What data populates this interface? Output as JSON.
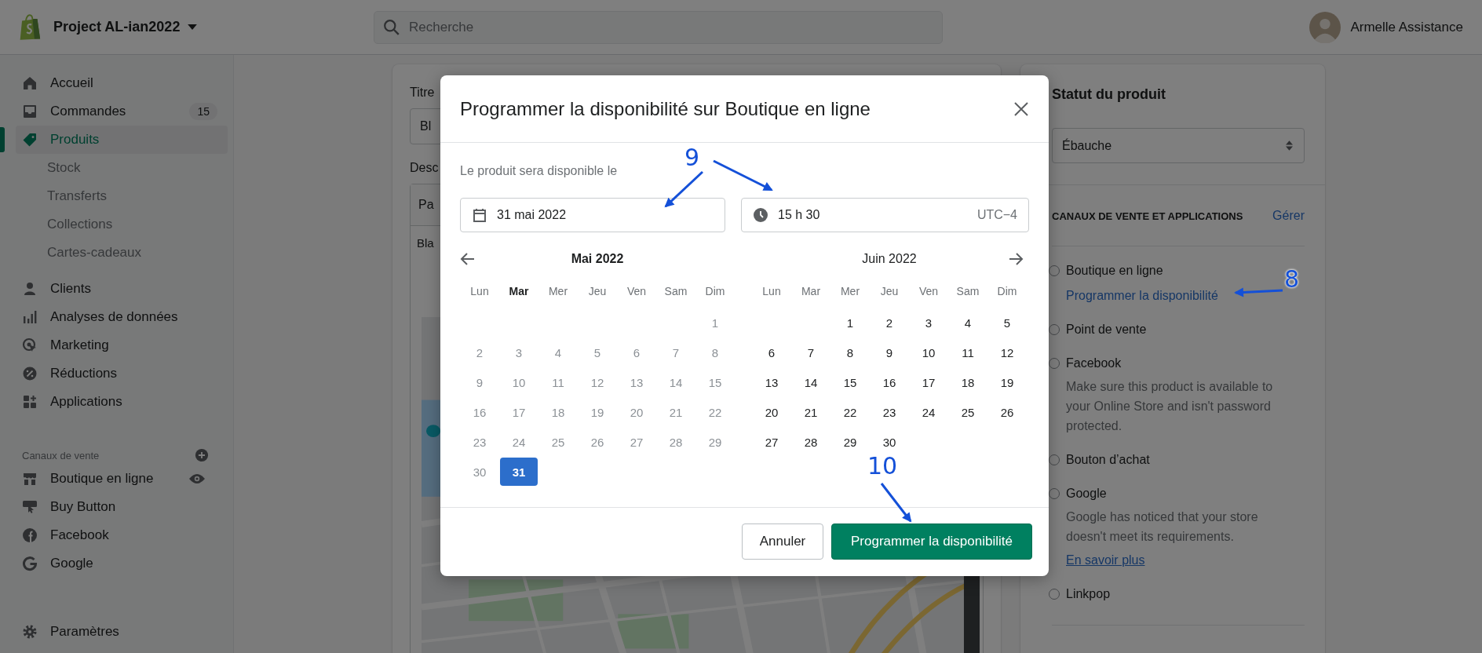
{
  "topbar": {
    "store_name": "Project AL-ian2022",
    "search": {
      "placeholder": "Recherche"
    },
    "user": {
      "name": "Armelle Assistance"
    }
  },
  "sidebar": {
    "items": [
      {
        "label": "Accueil",
        "selected": false
      },
      {
        "label": "Commandes",
        "badge": "15",
        "selected": false
      },
      {
        "label": "Produits",
        "selected": true,
        "children": [
          {
            "label": "Stock",
            "selected": false
          },
          {
            "label": "Transferts",
            "selected": false
          },
          {
            "label": "Collections",
            "selected": false
          },
          {
            "label": "Cartes-cadeaux",
            "selected": false
          }
        ]
      },
      {
        "label": "Clients",
        "selected": false
      },
      {
        "label": "Analyses de données",
        "selected": false
      },
      {
        "label": "Marketing",
        "selected": false
      },
      {
        "label": "Réductions",
        "selected": false
      },
      {
        "label": "Applications",
        "selected": false
      }
    ],
    "channels_heading": "Canaux de vente",
    "channels": [
      {
        "label": "Boutique en ligne"
      },
      {
        "label": "Buy Button"
      },
      {
        "label": "Facebook"
      },
      {
        "label": "Google"
      }
    ],
    "settings": {
      "label": "Paramètres"
    }
  },
  "product_form": {
    "title_label": "Titre",
    "title_value": "Bl",
    "description_label": "Desc",
    "editor_toolbar": "Pa",
    "editor_text": "Bla"
  },
  "status_card": {
    "title": "Statut du produit",
    "status_select": "Ébauche",
    "channels_heading": "CANAUX DE VENTE ET APPLICATIONS",
    "manage_link": "Gérer",
    "channels": [
      {
        "name": "Boutique en ligne",
        "checked": false,
        "link": "Programmer la disponibilité"
      },
      {
        "name": "Point de vente",
        "checked": false
      },
      {
        "name": "Facebook",
        "checked": false,
        "note": "Make sure this product is available to your Online Store and isn't password protected."
      },
      {
        "name": "Bouton d’achat",
        "checked": false
      },
      {
        "name": "Google",
        "checked": false,
        "note": "Google has noticed that your store doesn't meet its requirements.",
        "note_link": "En savoir plus"
      },
      {
        "name": "Linkpop",
        "checked": false
      }
    ]
  },
  "modal": {
    "title": "Programmer la disponibilité sur Boutique en ligne",
    "intro": "Le produit sera disponible le",
    "date_field": {
      "value": "31 mai 2022"
    },
    "time_field": {
      "value": "15 h 30",
      "timezone": "UTC−4"
    },
    "calendar": {
      "months": [
        {
          "title": "Mai 2022",
          "current": true,
          "weekdays": [
            {
              "label": "Lun",
              "current": false
            },
            {
              "label": "Mar",
              "current": true
            },
            {
              "label": "Mer",
              "current": false
            },
            {
              "label": "Jeu",
              "current": false
            },
            {
              "label": "Ven",
              "current": false
            },
            {
              "label": "Sam",
              "current": false
            },
            {
              "label": "Dim",
              "current": false
            }
          ],
          "weeks": [
            [
              {
                "kind": "blank"
              },
              {
                "kind": "blank"
              },
              {
                "kind": "blank"
              },
              {
                "kind": "blank"
              },
              {
                "kind": "blank"
              },
              {
                "kind": "blank"
              },
              {
                "kind": "day",
                "label": "1",
                "disabled": true,
                "selected": false
              }
            ],
            [
              {
                "kind": "day",
                "label": "2",
                "disabled": true,
                "selected": false
              },
              {
                "kind": "day",
                "label": "3",
                "disabled": true,
                "selected": false
              },
              {
                "kind": "day",
                "label": "4",
                "disabled": true,
                "selected": false
              },
              {
                "kind": "day",
                "label": "5",
                "disabled": true,
                "selected": false
              },
              {
                "kind": "day",
                "label": "6",
                "disabled": true,
                "selected": false
              },
              {
                "kind": "day",
                "label": "7",
                "disabled": true,
                "selected": false
              },
              {
                "kind": "day",
                "label": "8",
                "disabled": true,
                "selected": false
              }
            ],
            [
              {
                "kind": "day",
                "label": "9",
                "disabled": true,
                "selected": false
              },
              {
                "kind": "day",
                "label": "10",
                "disabled": true,
                "selected": false
              },
              {
                "kind": "day",
                "label": "11",
                "disabled": true,
                "selected": false
              },
              {
                "kind": "day",
                "label": "12",
                "disabled": true,
                "selected": false
              },
              {
                "kind": "day",
                "label": "13",
                "disabled": true,
                "selected": false
              },
              {
                "kind": "day",
                "label": "14",
                "disabled": true,
                "selected": false
              },
              {
                "kind": "day",
                "label": "15",
                "disabled": true,
                "selected": false
              }
            ],
            [
              {
                "kind": "day",
                "label": "16",
                "disabled": true,
                "selected": false
              },
              {
                "kind": "day",
                "label": "17",
                "disabled": true,
                "selected": false
              },
              {
                "kind": "day",
                "label": "18",
                "disabled": true,
                "selected": false
              },
              {
                "kind": "day",
                "label": "19",
                "disabled": true,
                "selected": false
              },
              {
                "kind": "day",
                "label": "20",
                "disabled": true,
                "selected": false
              },
              {
                "kind": "day",
                "label": "21",
                "disabled": true,
                "selected": false
              },
              {
                "kind": "day",
                "label": "22",
                "disabled": true,
                "selected": false
              }
            ],
            [
              {
                "kind": "day",
                "label": "23",
                "disabled": true,
                "selected": false
              },
              {
                "kind": "day",
                "label": "24",
                "disabled": true,
                "selected": false
              },
              {
                "kind": "day",
                "label": "25",
                "disabled": true,
                "selected": false
              },
              {
                "kind": "day",
                "label": "26",
                "disabled": true,
                "selected": false
              },
              {
                "kind": "day",
                "label": "27",
                "disabled": true,
                "selected": false
              },
              {
                "kind": "day",
                "label": "28",
                "disabled": true,
                "selected": false
              },
              {
                "kind": "day",
                "label": "29",
                "disabled": true,
                "selected": false
              }
            ],
            [
              {
                "kind": "day",
                "label": "30",
                "disabled": true,
                "selected": false
              },
              {
                "kind": "day",
                "label": "31",
                "disabled": false,
                "selected": true
              }
            ]
          ]
        },
        {
          "title": "Juin 2022",
          "current": false,
          "weekdays": [
            {
              "label": "Lun",
              "current": false
            },
            {
              "label": "Mar",
              "current": false
            },
            {
              "label": "Mer",
              "current": false
            },
            {
              "label": "Jeu",
              "current": false
            },
            {
              "label": "Ven",
              "current": false
            },
            {
              "label": "Sam",
              "current": false
            },
            {
              "label": "Dim",
              "current": false
            }
          ],
          "weeks": [
            [
              {
                "kind": "blank"
              },
              {
                "kind": "blank"
              },
              {
                "kind": "day",
                "label": "1",
                "disabled": false,
                "selected": false
              },
              {
                "kind": "day",
                "label": "2",
                "disabled": false,
                "selected": false
              },
              {
                "kind": "day",
                "label": "3",
                "disabled": false,
                "selected": false
              },
              {
                "kind": "day",
                "label": "4",
                "disabled": false,
                "selected": false
              },
              {
                "kind": "day",
                "label": "5",
                "disabled": false,
                "selected": false
              }
            ],
            [
              {
                "kind": "day",
                "label": "6",
                "disabled": false,
                "selected": false
              },
              {
                "kind": "day",
                "label": "7",
                "disabled": false,
                "selected": false
              },
              {
                "kind": "day",
                "label": "8",
                "disabled": false,
                "selected": false
              },
              {
                "kind": "day",
                "label": "9",
                "disabled": false,
                "selected": false
              },
              {
                "kind": "day",
                "label": "10",
                "disabled": false,
                "selected": false
              },
              {
                "kind": "day",
                "label": "11",
                "disabled": false,
                "selected": false
              },
              {
                "kind": "day",
                "label": "12",
                "disabled": false,
                "selected": false
              }
            ],
            [
              {
                "kind": "day",
                "label": "13",
                "disabled": false,
                "selected": false
              },
              {
                "kind": "day",
                "label": "14",
                "disabled": false,
                "selected": false
              },
              {
                "kind": "day",
                "label": "15",
                "disabled": false,
                "selected": false
              },
              {
                "kind": "day",
                "label": "16",
                "disabled": false,
                "selected": false
              },
              {
                "kind": "day",
                "label": "17",
                "disabled": false,
                "selected": false
              },
              {
                "kind": "day",
                "label": "18",
                "disabled": false,
                "selected": false
              },
              {
                "kind": "day",
                "label": "19",
                "disabled": false,
                "selected": false
              }
            ],
            [
              {
                "kind": "day",
                "label": "20",
                "disabled": false,
                "selected": false
              },
              {
                "kind": "day",
                "label": "21",
                "disabled": false,
                "selected": false
              },
              {
                "kind": "day",
                "label": "22",
                "disabled": false,
                "selected": false
              },
              {
                "kind": "day",
                "label": "23",
                "disabled": false,
                "selected": false
              },
              {
                "kind": "day",
                "label": "24",
                "disabled": false,
                "selected": false
              },
              {
                "kind": "day",
                "label": "25",
                "disabled": false,
                "selected": false
              },
              {
                "kind": "day",
                "label": "26",
                "disabled": false,
                "selected": false
              }
            ],
            [
              {
                "kind": "day",
                "label": "27",
                "disabled": false,
                "selected": false
              },
              {
                "kind": "day",
                "label": "28",
                "disabled": false,
                "selected": false
              },
              {
                "kind": "day",
                "label": "29",
                "disabled": false,
                "selected": false
              },
              {
                "kind": "day",
                "label": "30",
                "disabled": false,
                "selected": false
              }
            ]
          ]
        }
      ]
    },
    "buttons": [
      {
        "label": "Annuler",
        "kind": "secondary"
      },
      {
        "label": "Programmer la disponibilité",
        "kind": "primary"
      }
    ]
  },
  "callouts": [
    {
      "label": "9"
    },
    {
      "label": "8"
    },
    {
      "label": "10"
    }
  ]
}
